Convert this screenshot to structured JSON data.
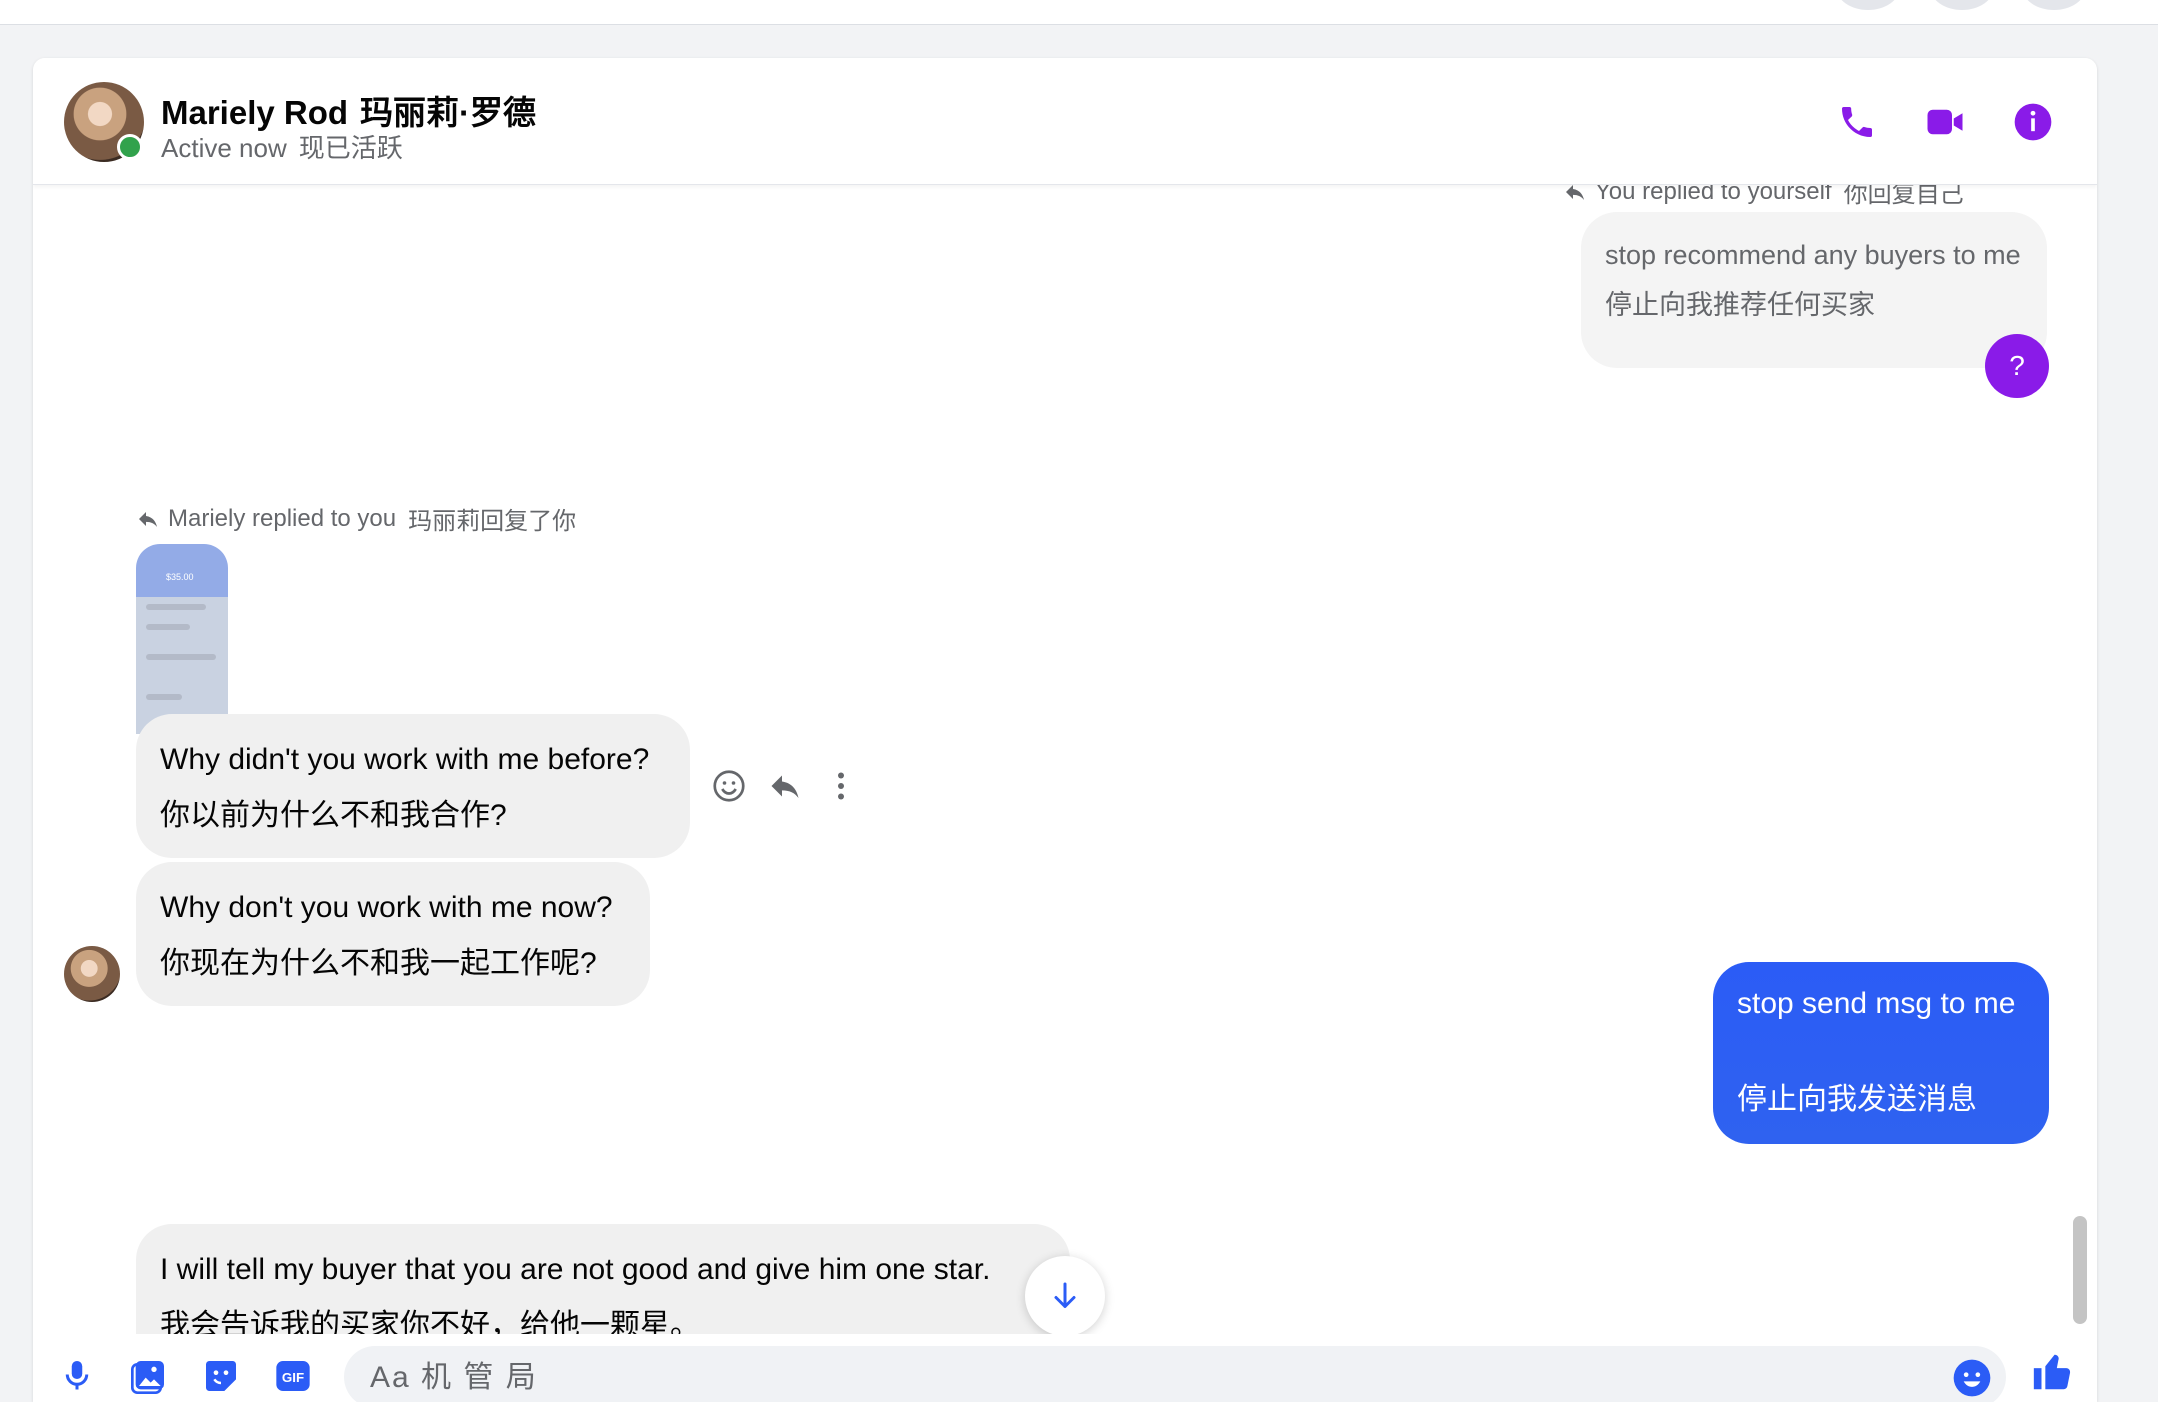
{
  "header": {
    "name": "Mariely Rod",
    "name_translation": "玛丽莉·罗德",
    "status": "Active now",
    "status_translation": "现已活跃"
  },
  "messages": {
    "reply_note_top": "You replied to yourself",
    "reply_note_top_translation": "你回复自己",
    "msg_stop_recommend": "stop recommend any buyers to me",
    "msg_stop_recommend_translation": "停止向我推荐任何买家",
    "question_mark": "?",
    "reply_note_mariely": "Mariely replied to you",
    "reply_note_mariely_translation": "玛丽莉回复了你",
    "thumb_price": "$35.00",
    "msg_why_before": "Why didn't you work with me before?",
    "msg_why_before_translation": "你以前为什么不和我合作?",
    "msg_why_now": "Why don't you work with me now?",
    "msg_why_now_translation": "你现在为什么不和我一起工作呢?",
    "msg_stop_send": "stop send msg to me",
    "msg_stop_send_translation": "停止向我发送消息",
    "msg_tell_buyer": "I will tell my buyer that you are not good and give him one star.",
    "msg_tell_buyer_translation": "我会告诉我的买家你不好，给他一颗星。"
  },
  "composer": {
    "placeholder": "Aa 机 管 局"
  },
  "icons": {
    "phone": "phone-icon",
    "video": "video-camera-icon",
    "info": "info-icon",
    "mic": "microphone-icon",
    "gallery": "gallery-icon",
    "sticker": "sticker-icon",
    "gif": "gif-icon",
    "emoji": "emoji-icon",
    "like": "thumbs-up-icon",
    "react": "smiley-icon",
    "reply": "reply-icon",
    "more": "more-vertical-icon",
    "scroll_down": "arrow-down-icon"
  },
  "colors": {
    "accent": "#8a1be8",
    "outgoing_bubble": "#2b5cf6",
    "incoming_bubble": "#f0f0f0",
    "online": "#31a24c"
  }
}
